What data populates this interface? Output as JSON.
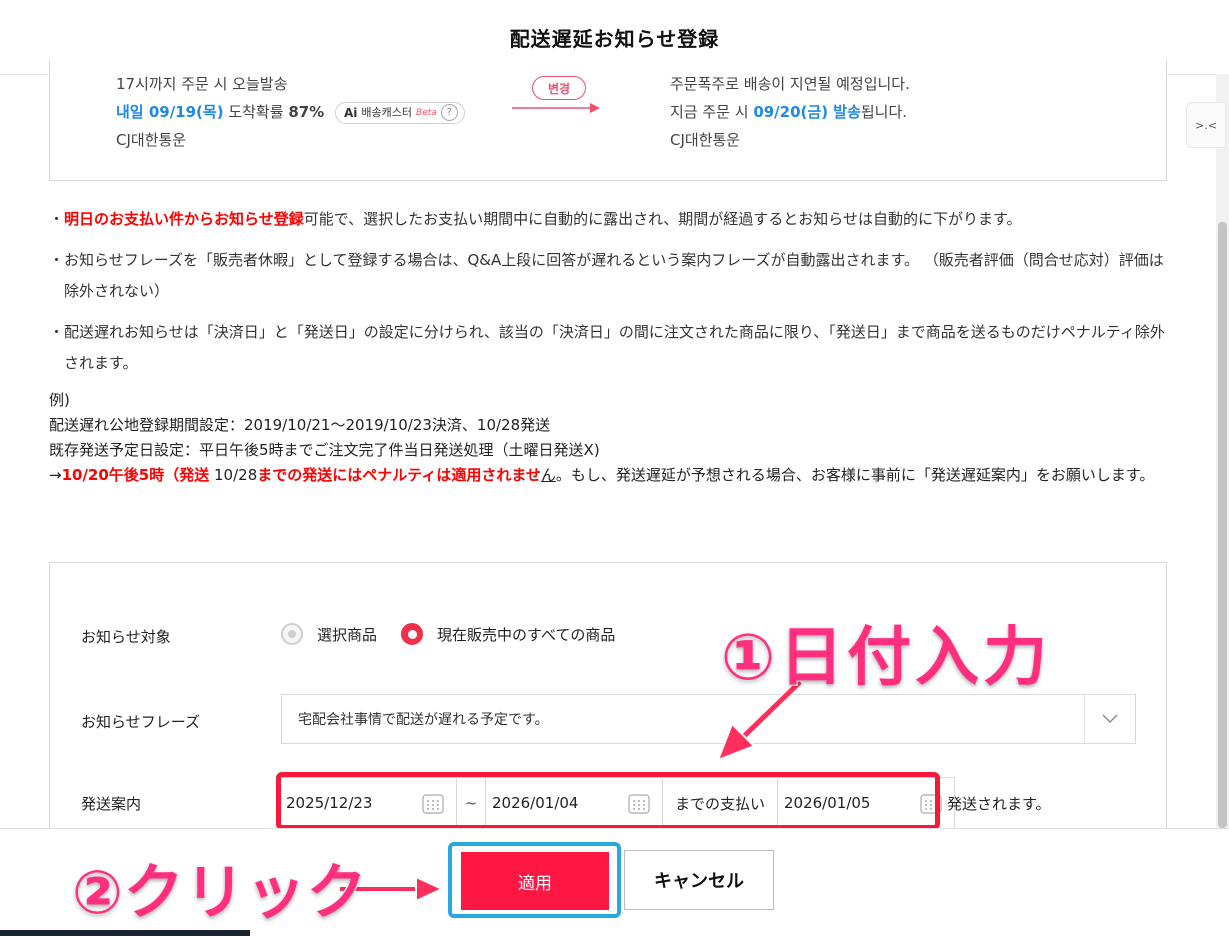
{
  "modal": {
    "title": "配送遅延お知らせ登録"
  },
  "preview": {
    "left": {
      "line1": "17시까지 주문 시 오늘발송",
      "line2_blue": "내일 09/19(목)",
      "line2_mid": " 도착확률 ",
      "line2_pct": "87%",
      "badge_ai": "Ai",
      "badge_text": "배송캐스터",
      "badge_beta": "Beta",
      "badge_q": "?",
      "line3": "CJ대한통운"
    },
    "change_label": "변경",
    "right": {
      "line1": "주문폭주로 배송이 지연될 예정입니다.",
      "line2_pre": "지금 주문 시 ",
      "line2_blue": "09/20(금) 발송",
      "line2_post": "됩니다.",
      "line3": "CJ대한통운"
    }
  },
  "notes": {
    "bullet": "・",
    "n1_red": "明日のお支払い件からお知らせ登録",
    "n1_rest": "可能で、選択したお支払い期間中に自動的に露出され、期間が経過するとお知らせは自動的に下がります。",
    "n2": "お知らせフレーズを「販売者休暇」として登録する場合は、Q&A上段に回答が遅れるという案内フレーズが自動露出されます。 （販売者評価（問合せ応対）評価は除外されない）",
    "n3": "配送遅れお知らせは「決済日」と「発送日」の設定に分けられ、該当の「決済日」の間に注文された商品に限り、「発送日」まで商品を送るものだけペナルティ除外されます。"
  },
  "example": {
    "heading": "例)",
    "line1": "配送遅れ公地登録期間設定：2019/10/21～2019/10/23決済、10/28発送",
    "line2": "既存発送予定日設定：平日午後5時までご注文完了件当日発送処理（土曜日発送X)",
    "arrow": "→",
    "red1": "10/20午後5時（発送",
    "plain1": " 10/28",
    "red2": "までの発送にはペナルティは適用されませ",
    "under": "ん",
    "rest": "。もし、発送遅延が予想される場合、お客様に事前に「発送遅延案内」をお願いします。"
  },
  "form": {
    "target_label": "お知らせ対象",
    "radio_options": [
      "選択商品",
      "現在販売中のすべての商品"
    ],
    "phrase_label": "お知らせフレーズ",
    "phrase_value": "宅配会社事情で配送が遅れる予定です。",
    "shipping_label": "発送案内",
    "date_start": "2025/12/23",
    "tilde": "~",
    "date_end": "2026/01/04",
    "mid_label": "までの支払い",
    "ship_date": "2026/01/05",
    "after_text": "発送されます。"
  },
  "footer": {
    "apply": "適用",
    "cancel": "キャンセル"
  },
  "annotations": {
    "step1": "①日付入力",
    "step2": "②クリック"
  },
  "side_tab": {
    "label": ">.<"
  },
  "colors": {
    "accent": "#ff1744",
    "link_blue": "#1e88e5",
    "annotation": "#ff2e7e",
    "highlight_blue": "#29a8e0"
  }
}
